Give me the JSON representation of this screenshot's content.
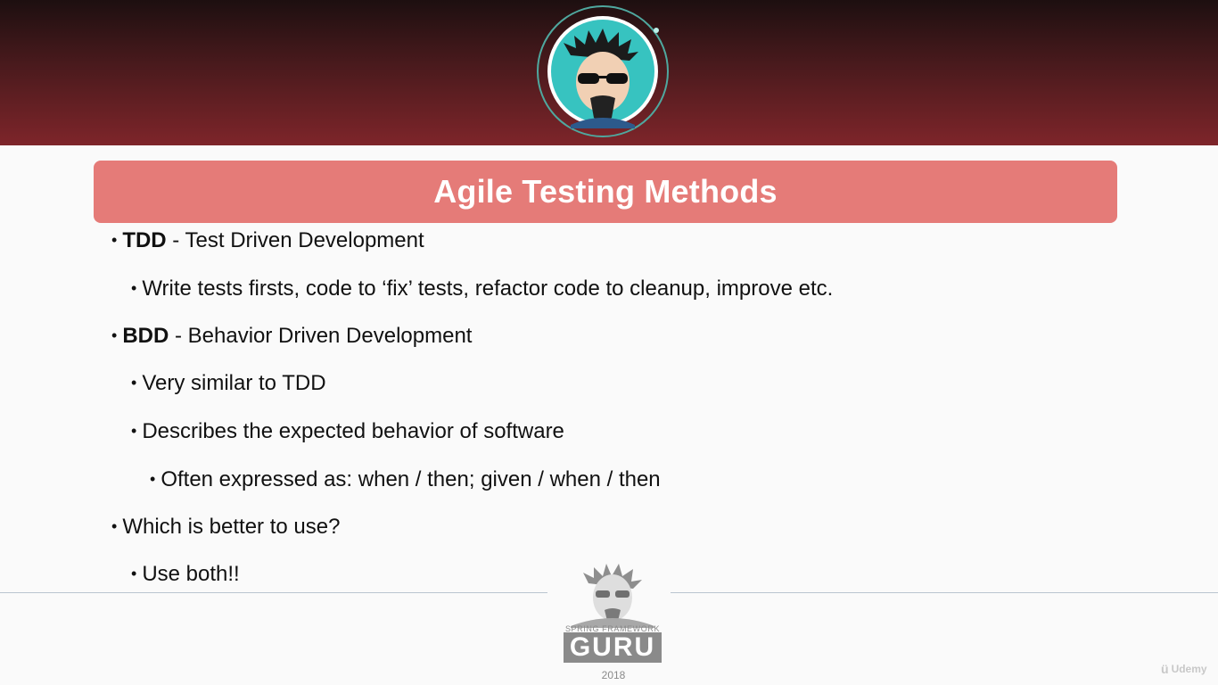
{
  "slide": {
    "title": "Agile Testing Methods",
    "bullets": [
      {
        "level": 1,
        "bold": "TDD",
        "text": " - Test Driven Development"
      },
      {
        "level": 2,
        "text": "Write tests firsts, code to ‘fix’ tests, refactor code to cleanup, improve etc."
      },
      {
        "level": 1,
        "bold": "BDD",
        "text": " - Behavior Driven Development"
      },
      {
        "level": 2,
        "text": "Very similar to TDD"
      },
      {
        "level": 2,
        "text": "Describes the expected behavior of software"
      },
      {
        "level": 3,
        "text": "Often expressed as: when / then; given / when / then"
      },
      {
        "level": 1,
        "text": "Which is better to use?"
      },
      {
        "level": 2,
        "text": "Use both!!"
      }
    ]
  },
  "footer": {
    "logo_caption": "SPRING FRAMEWORK",
    "logo_word": "GURU",
    "year": "2018"
  },
  "watermark": {
    "text": "Udemy"
  },
  "colors": {
    "header_dark": "#1d0f10",
    "header_red": "#7e252a",
    "title_bar": "#e57b78",
    "avatar_teal": "#37c3c0",
    "ring": "#4fa89f"
  },
  "icons": {
    "header_avatar": "guru-avatar-icon",
    "footer_logo": "guru-logo-icon",
    "watermark": "udemy-icon"
  }
}
